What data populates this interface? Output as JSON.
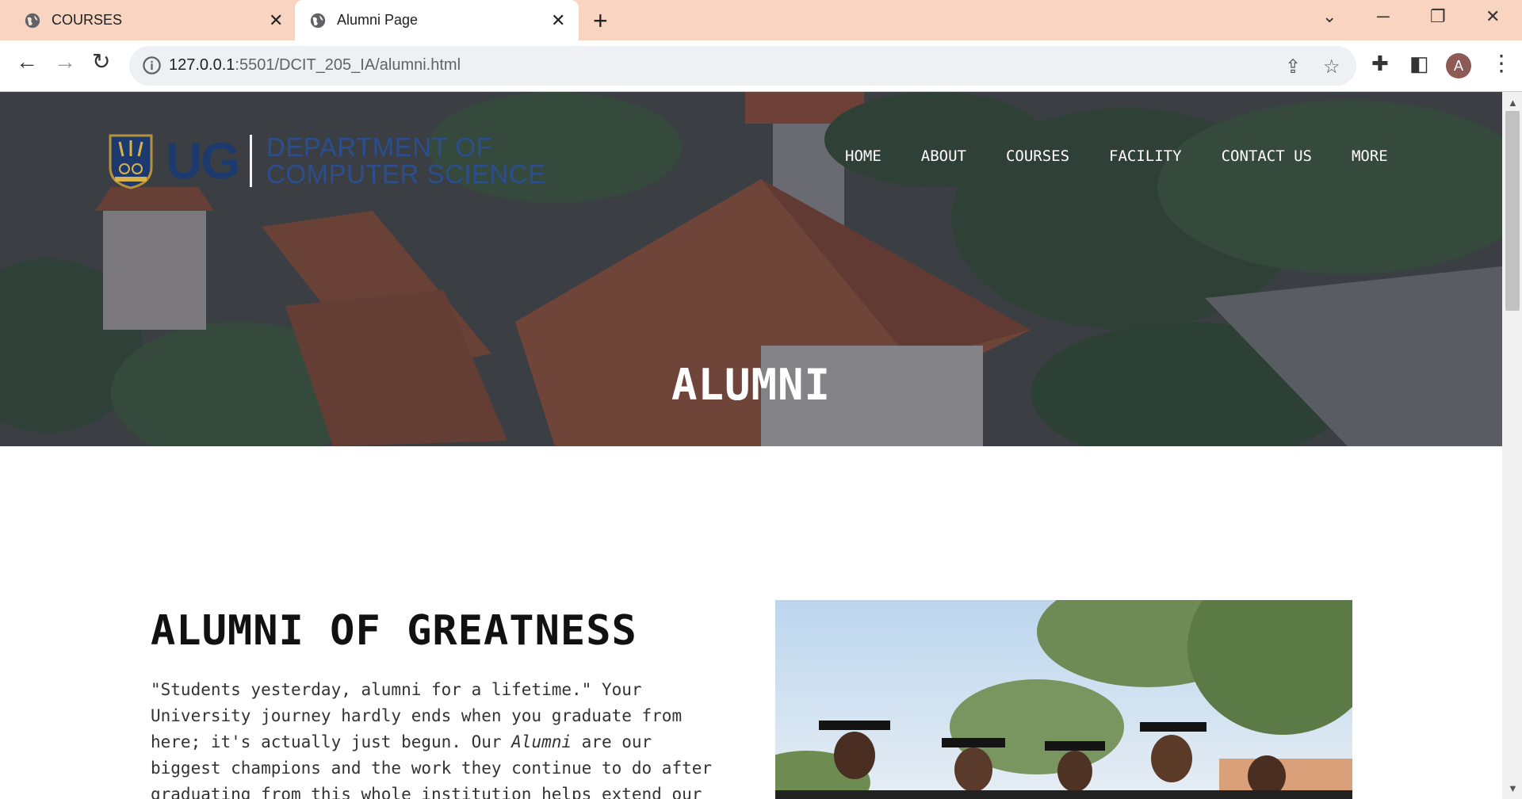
{
  "browser": {
    "tabs": [
      {
        "title": "COURSES",
        "active": false
      },
      {
        "title": "Alumni Page",
        "active": true
      }
    ],
    "url_host": "127.0.0.1",
    "url_path": ":5501/DCIT_205_IA/alumni.html",
    "profile_initial": "A"
  },
  "header": {
    "logo_text": "UG",
    "department_line1": "DEPARTMENT OF",
    "department_line2": "COMPUTER SCIENCE",
    "nav": [
      "HOME",
      "ABOUT",
      "COURSES",
      "FACILITY",
      "CONTACT US",
      "MORE"
    ]
  },
  "hero": {
    "title": "ALUMNI"
  },
  "about": {
    "heading": "ALUMNI OF GREATNESS",
    "text_before": "\"Students yesterday, alumni for a lifetime.\" Your University journey hardly ends when you graduate from here; it's actually just begun. Our ",
    "text_emph": "Alumni",
    "text_after": " are our biggest champions and the work they continue to do after graduating from this whole institution helps extend our"
  },
  "colors": {
    "tabbar": "#f9d5c1",
    "logo_blue": "#1c3a6e",
    "hero_overlay": "#1c223a"
  }
}
